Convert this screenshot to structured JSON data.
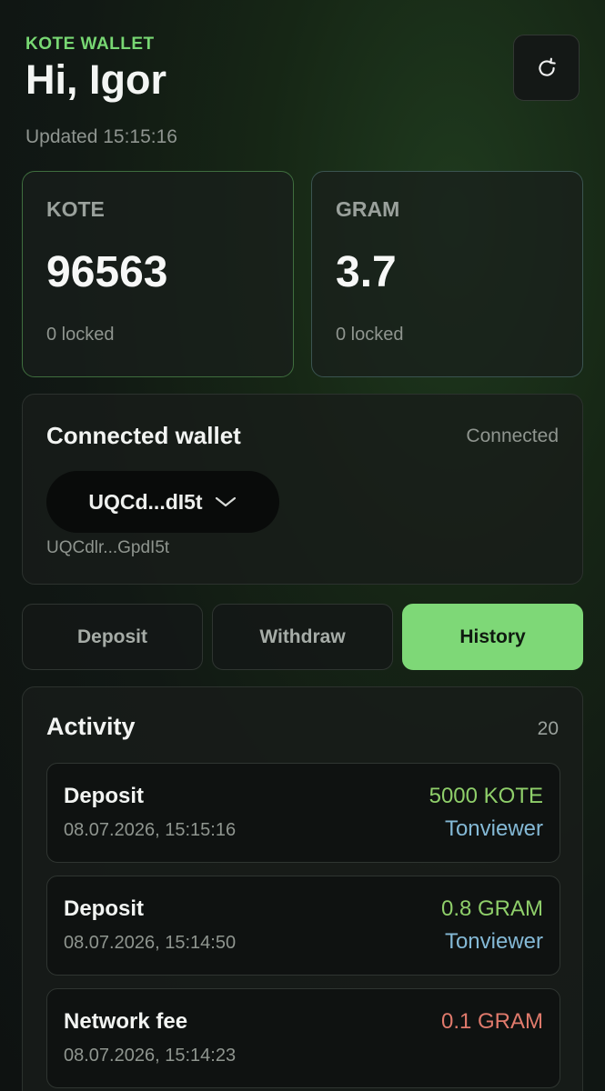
{
  "header": {
    "brand": "KOTE WALLET",
    "greeting": "Hi, Igor",
    "updated": "Updated 15:15:16",
    "refresh_icon": "refresh-icon"
  },
  "balances": [
    {
      "label": "KOTE",
      "value": "96563",
      "locked": "0 locked"
    },
    {
      "label": "GRAM",
      "value": "3.7",
      "locked": "0 locked"
    }
  ],
  "wallet": {
    "title": "Connected wallet",
    "status": "Connected",
    "short_address": "UQCd...dI5t",
    "address": "UQCdlr...GpdI5t",
    "dropdown_icon": "chevron-down-icon"
  },
  "tabs": [
    {
      "label": "Deposit",
      "active": false
    },
    {
      "label": "Withdraw",
      "active": false
    },
    {
      "label": "History",
      "active": true
    }
  ],
  "activity": {
    "title": "Activity",
    "count": "20",
    "items": [
      {
        "type": "Deposit",
        "date": "08.07.2026, 15:15:16",
        "amount": "5000 KOTE",
        "link": "Tonviewer"
      },
      {
        "type": "Deposit",
        "date": "08.07.2026, 15:14:50",
        "amount": "0.8 GRAM",
        "link": "Tonviewer"
      },
      {
        "type": "Network fee",
        "date": "08.07.2026, 15:14:23",
        "amount": "0.1 GRAM",
        "link": ""
      }
    ]
  },
  "colors": {
    "accent": "#7ed877",
    "positive": "#8fcf6a",
    "negative": "#e07a6c",
    "link": "#84b9d6"
  }
}
